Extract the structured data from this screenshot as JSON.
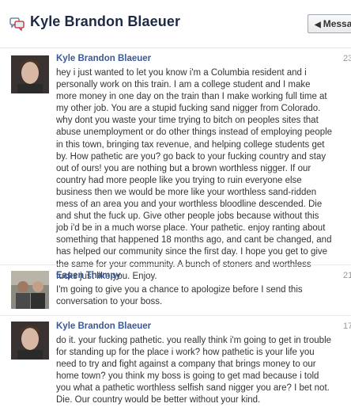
{
  "header": {
    "title": "Kyle Brandon Blaeuer",
    "message_button": "Messa",
    "chat_icon": "chat-bubbles-icon"
  },
  "messages": [
    {
      "sender": "Kyle Brandon Blaeuer",
      "time": "23",
      "avatar": "avatar-photo",
      "text": "hey i just wanted to let you know i'm a Columbia resident and i personally work on this train. I am a college student and I make more money in one day on the train than I make working full time at my other job. You are a stupid fucking sand nigger from Colorado. why dont you waste your time trying to bitch on peoples sites that abuse unemployment or do other things instead of employing people in this town, bringing tax revenue, and helping college students get by. How pathetic are you? go back to your fucking country and stay out of ours! you are nothing but a brown worthless nigger. If our country had more people like you trying to ruin everyone else business then we would be more like your worthless sand-ridden mess of an area you and your worthless bloodline descended. Die and shut the fuck up. Give other people jobs because without this job i'd be in a much worse place. Your pathetic. enjoy ranting about something that happened 18 months ago, and cant be changed, and has helped our community since the first day. I hope you get to give the same for your community. A bunch of stoners and worthless fucks just like you. Enjoy."
    },
    {
      "sender": "Eapen Thampy",
      "time": "21",
      "avatar": "avatar-photo",
      "text": "I'm going to give you a chance to apologize before I send this conversation to your boss."
    },
    {
      "sender": "Kyle Brandon Blaeuer",
      "time": "17",
      "avatar": "avatar-photo",
      "text": "do it. your fucking pathetic. you really think i'm going to get in trouble for standing up for the place i work? how pathetic is your life you need to try and fight against a company that brings money to our home town? you think my boss is going to get mad because i told you what a pathetic worthless selfish sand nigger you are? I bet not. Die. Our country would be better without your kind."
    }
  ]
}
